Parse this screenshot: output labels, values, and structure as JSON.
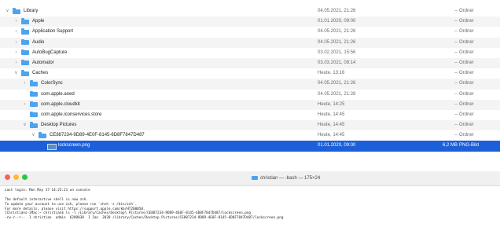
{
  "finder": {
    "rows": [
      {
        "name": "Library",
        "date": "04.05.2021, 21:26",
        "size": "--",
        "kind": "Ordner",
        "expanded": true,
        "indent": 0,
        "icon": "folder-icon"
      },
      {
        "name": "Apple",
        "date": "01.01.2020, 09:00",
        "size": "--",
        "kind": "Ordner",
        "expanded": false,
        "indent": 1,
        "icon": "folder-icon"
      },
      {
        "name": "Application Support",
        "date": "04.05.2021, 21:26",
        "size": "--",
        "kind": "Ordner",
        "expanded": false,
        "indent": 1,
        "icon": "folder-icon"
      },
      {
        "name": "Audio",
        "date": "04.05.2021, 21:26",
        "size": "--",
        "kind": "Ordner",
        "expanded": false,
        "indent": 1,
        "icon": "folder-icon"
      },
      {
        "name": "AutoBugCapture",
        "date": "03.02.2021, 15:56",
        "size": "--",
        "kind": "Ordner",
        "expanded": false,
        "indent": 1,
        "icon": "folder-icon"
      },
      {
        "name": "Automator",
        "date": "03.03.2021, 08:14",
        "size": "--",
        "kind": "Ordner",
        "expanded": false,
        "indent": 1,
        "icon": "folder-icon"
      },
      {
        "name": "Caches",
        "date": "Heute, 13:16",
        "size": "--",
        "kind": "Ordner",
        "expanded": true,
        "indent": 1,
        "icon": "folder-icon"
      },
      {
        "name": "ColorSync",
        "date": "04.05.2021, 21:26",
        "size": "--",
        "kind": "Ordner",
        "expanded": false,
        "indent": 2,
        "icon": "folder-icon"
      },
      {
        "name": "com.apple.aned",
        "date": "04.05.2021, 21:28",
        "size": "--",
        "kind": "Ordner",
        "expanded": null,
        "indent": 2,
        "icon": "folder-icon"
      },
      {
        "name": "com.apple.cloudkit",
        "date": "Heute, 14:25",
        "size": "--",
        "kind": "Ordner",
        "expanded": false,
        "indent": 2,
        "icon": "folder-icon"
      },
      {
        "name": "com.apple.iconservices.store",
        "date": "Heute, 14:45",
        "size": "--",
        "kind": "Ordner",
        "expanded": null,
        "indent": 2,
        "icon": "folder-icon"
      },
      {
        "name": "Desktop Pictures",
        "date": "Heute, 14:45",
        "size": "--",
        "kind": "Ordner",
        "expanded": true,
        "indent": 2,
        "icon": "folder-icon"
      },
      {
        "name": "CE887234-9D89-4E0F-8145-6D8F7847D487",
        "date": "Heute, 14:45",
        "size": "--",
        "kind": "Ordner",
        "expanded": true,
        "indent": 3,
        "icon": "folder-icon"
      },
      {
        "name": "lockscreen.png",
        "date": "01.01.2020, 09:00",
        "size": "6,2 MB",
        "kind": "PNG-Bild",
        "expanded": null,
        "indent": 4,
        "icon": "image-file-icon",
        "selected": true
      }
    ]
  },
  "terminal": {
    "title": "christian — -bash — 175×24",
    "lines": [
      "Last login: Mon May 17 14:25:21 on console",
      "",
      "The default interactive shell is now zsh.",
      "To update your account to use zsh, please run `chsh -s /bin/zsh`.",
      "For more details, please visit https://support.apple.com/kb/HT208050.",
      "[Christians-iMac:~ christian$ ls -l /Library/Caches/Desktop\\ Pictures/CE887234-9D89-4E0F-8145-6D8F7847D487/lockscreen.png",
      "-rw-r--r--  1 christian  admin  6209030  1 Jan  2020 /Library/Caches/Desktop Pictures/CE887234-9D89-4E0F-8145-6D8F7847D487/lockscreen.png"
    ]
  },
  "colors": {
    "selection": "#1c5fd8",
    "folder": "#4da3ee",
    "close": "#fe5f57",
    "minimize": "#febc2e",
    "zoom": "#28c840"
  }
}
